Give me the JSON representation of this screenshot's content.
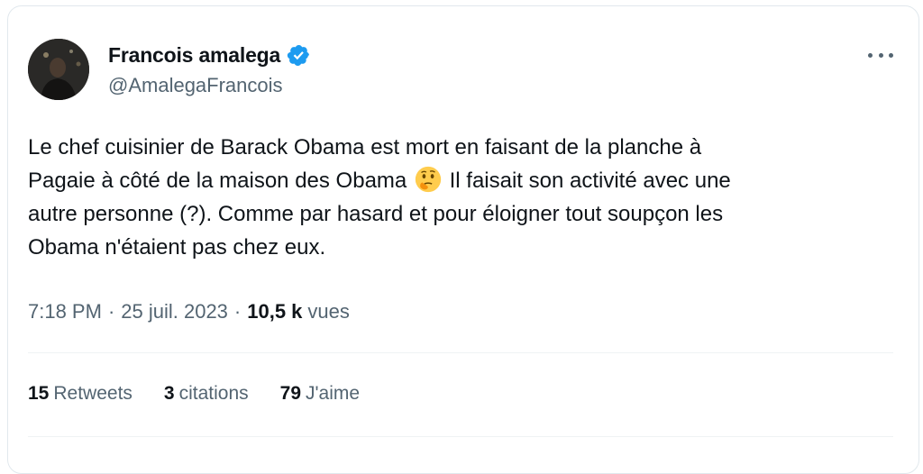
{
  "author": {
    "display_name": "Francois amalega",
    "handle": "@AmalegaFrancois",
    "verified": true,
    "verified_color": "#1d9bf0"
  },
  "tweet": {
    "text_part1": "Le chef cuisinier de Barack Obama est mort en faisant de la planche à\nPagaie à côté de la maison des Obama ",
    "emoji": "thinking-face",
    "text_part2": " Il faisait son activité avec une\nautre personne (?). Comme par hasard et pour éloigner tout soupçon les\nObama n'étaient pas chez eux."
  },
  "meta": {
    "time": "7:18 PM",
    "separator": "·",
    "date": "25 juil. 2023",
    "views_count": "10,5 k",
    "views_label": "vues"
  },
  "stats": {
    "retweets_count": "15",
    "retweets_label": "Retweets",
    "quotes_count": "3",
    "quotes_label": "citations",
    "likes_count": "79",
    "likes_label": "J'aime"
  },
  "colors": {
    "text_primary": "#0f1419",
    "text_secondary": "#536471",
    "divider": "#eff3f4"
  }
}
